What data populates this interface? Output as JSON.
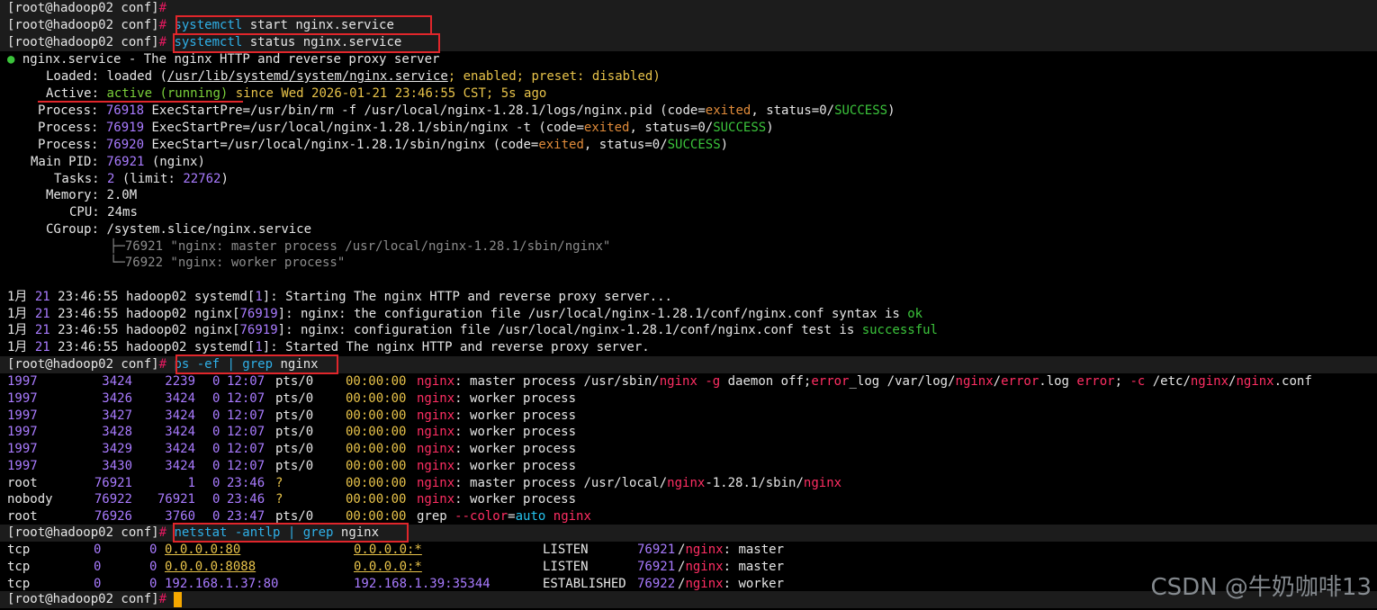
{
  "prompt": "[root@hadoop02 conf]",
  "hash": "#",
  "commands": {
    "start": {
      "cmd": "systemctl",
      "args": " start nginx.service"
    },
    "status": {
      "cmd": "systemctl",
      "args": " status nginx.service"
    },
    "ps": {
      "cmd": "ps -ef | grep",
      "args": " nginx"
    },
    "netstat": {
      "cmd": "netstat -antlp | grep",
      "args": " nginx"
    }
  },
  "status": {
    "bullet": "●",
    "unit": "nginx.service",
    "desc_sep": " - ",
    "desc": "The nginx HTTP and reverse proxy server",
    "loaded_label": "Loaded:",
    "loaded_a": "loaded (",
    "loaded_path": "/usr/lib/systemd/system/nginx.service",
    "loaded_b": "; enabled; preset: disabled)",
    "active_label": "Active:",
    "active_state": "active (running)",
    "active_since": " since Wed 2026-01-21 23:46:55 CST; 5s ago",
    "process_label": "Process:",
    "processes": [
      {
        "pid": "76918",
        "text1": " ExecStartPre=/usr/bin/rm -f /usr/local/nginx-1.28.1/logs/nginx.pid (code=",
        "code": "exited",
        "text2": ", status=0/",
        "status": "SUCCESS",
        "end": ")"
      },
      {
        "pid": "76919",
        "text1": " ExecStartPre=/usr/local/nginx-1.28.1/sbin/nginx -t (code=",
        "code": "exited",
        "text2": ", status=0/",
        "status": "SUCCESS",
        "end": ")"
      },
      {
        "pid": "76920",
        "text1": " ExecStart=/usr/local/nginx-1.28.1/sbin/nginx (code=",
        "code": "exited",
        "text2": ", status=0/",
        "status": "SUCCESS",
        "end": ")"
      }
    ],
    "mainpid_label": "Main PID:",
    "mainpid": "76921",
    "mainpid_name": " (nginx)",
    "tasks_label": "Tasks:",
    "tasks": "2",
    "tasks_limit_a": " (limit: ",
    "tasks_limit": "22762",
    "tasks_limit_b": ")",
    "memory_label": "Memory:",
    "memory": "2.0M",
    "cpu_label": "CPU:",
    "cpu": "24ms",
    "cgroup_label": "CGroup:",
    "cgroup": "/system.slice/nginx.service",
    "tree1": "├─76921 \"nginx: master process /usr/local/nginx-1.28.1/sbin/nginx\"",
    "tree2": "└─76922 \"nginx: worker process\""
  },
  "journal": [
    {
      "date": "1月",
      "day": "21",
      "time": "23:46:55",
      "host": " hadoop02 ",
      "src": "systemd",
      "pid": "1",
      "msg_a": ": Starting The nginx HTTP and reverse proxy server...",
      "hl": "",
      "msg_b": ""
    },
    {
      "date": "1月",
      "day": "21",
      "time": "23:46:55",
      "host": " hadoop02 ",
      "src": "nginx",
      "pid": "76919",
      "msg_a": ": nginx: the configuration file /usr/local/nginx-1.28.1/conf/nginx.conf syntax is ",
      "hl": "ok",
      "msg_b": ""
    },
    {
      "date": "1月",
      "day": "21",
      "time": "23:46:55",
      "host": " hadoop02 ",
      "src": "nginx",
      "pid": "76919",
      "msg_a": ": nginx: configuration file /usr/local/nginx-1.28.1/conf/nginx.conf test is ",
      "hl": "successful",
      "msg_b": ""
    },
    {
      "date": "1月",
      "day": "21",
      "time": "23:46:55",
      "host": " hadoop02 ",
      "src": "systemd",
      "pid": "1",
      "msg_a": ": Started The nginx HTTP and reverse proxy server.",
      "hl": "",
      "msg_b": ""
    }
  ],
  "ps_rows": [
    {
      "uid": "1997",
      "pid": "3424",
      "ppid": "2239",
      "c": "0",
      "stime": "12:07",
      "tty": "pts/0",
      "time": "00:00:00",
      "cmd": "nginx: master process /usr/sbin/nginx -g daemon off;error_log /var/log/nginx/error.log error; -c /etc/nginx/nginx.conf"
    },
    {
      "uid": "1997",
      "pid": "3426",
      "ppid": "3424",
      "c": "0",
      "stime": "12:07",
      "tty": "pts/0",
      "time": "00:00:00",
      "cmd": "nginx: worker process"
    },
    {
      "uid": "1997",
      "pid": "3427",
      "ppid": "3424",
      "c": "0",
      "stime": "12:07",
      "tty": "pts/0",
      "time": "00:00:00",
      "cmd": "nginx: worker process"
    },
    {
      "uid": "1997",
      "pid": "3428",
      "ppid": "3424",
      "c": "0",
      "stime": "12:07",
      "tty": "pts/0",
      "time": "00:00:00",
      "cmd": "nginx: worker process"
    },
    {
      "uid": "1997",
      "pid": "3429",
      "ppid": "3424",
      "c": "0",
      "stime": "12:07",
      "tty": "pts/0",
      "time": "00:00:00",
      "cmd": "nginx: worker process"
    },
    {
      "uid": "1997",
      "pid": "3430",
      "ppid": "3424",
      "c": "0",
      "stime": "12:07",
      "tty": "pts/0",
      "time": "00:00:00",
      "cmd": "nginx: worker process"
    },
    {
      "uid": "root",
      "pid": "76921",
      "ppid": "1",
      "c": "0",
      "stime": "23:46",
      "tty": "?",
      "time": "00:00:00",
      "cmd": "nginx: master process /usr/local/nginx-1.28.1/sbin/nginx"
    },
    {
      "uid": "nobody",
      "pid": "76922",
      "ppid": "76921",
      "c": "0",
      "stime": "23:46",
      "tty": "?",
      "time": "00:00:00",
      "cmd": "nginx: worker process"
    },
    {
      "uid": "root",
      "pid": "76926",
      "ppid": "3760",
      "c": "0",
      "stime": "23:47",
      "tty": "pts/0",
      "time": "00:00:00",
      "cmd": "grep --color=auto nginx"
    }
  ],
  "net_rows": [
    {
      "proto": "tcp",
      "recv": "0",
      "send": "0",
      "local": "0.0.0.0:80",
      "foreign": "0.0.0.0:*",
      "state": "LISTEN",
      "pid": "76921",
      "prog": "nginx",
      "role": ": master"
    },
    {
      "proto": "tcp",
      "recv": "0",
      "send": "0",
      "local": "0.0.0.0:8088",
      "foreign": "0.0.0.0:*",
      "state": "LISTEN",
      "pid": "76921",
      "prog": "nginx",
      "role": ": master"
    },
    {
      "proto": "tcp",
      "recv": "0",
      "send": "0",
      "local": "192.168.1.37:80",
      "foreign": "192.168.1.39:35344",
      "state": "ESTABLISHED",
      "pid": "76922",
      "prog": "nginx",
      "role": ": worker"
    }
  ],
  "watermark": "CSDN @牛奶咖啡13",
  "colors": {
    "highlight_box": "#e0262b",
    "prompt_hash": "#e0195e",
    "cursor": "#f5a800"
  }
}
